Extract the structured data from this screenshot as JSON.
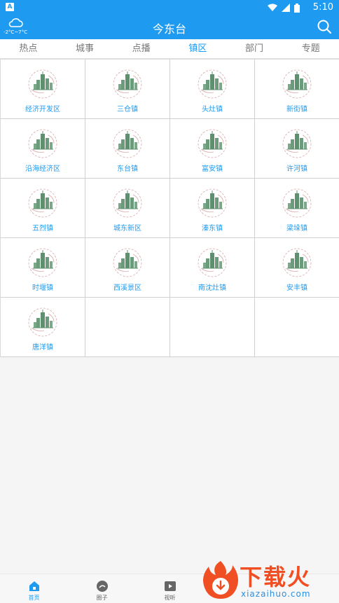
{
  "status": {
    "app_badge": "A",
    "time": "5:10"
  },
  "header": {
    "title": "今东台",
    "weather_temp": "-2°C~7°C",
    "weather_icon": "cloud-icon",
    "search_icon": "search-icon"
  },
  "tabs": [
    {
      "label": "热点"
    },
    {
      "label": "城事"
    },
    {
      "label": "点播"
    },
    {
      "label": "镇区",
      "active": true
    },
    {
      "label": "部门"
    },
    {
      "label": "专题"
    }
  ],
  "grid": {
    "items": [
      {
        "label": "经济开发区"
      },
      {
        "label": "三仓镇"
      },
      {
        "label": "头灶镇"
      },
      {
        "label": "新街镇"
      },
      {
        "label": "沿海经济区"
      },
      {
        "label": "东台镇"
      },
      {
        "label": "富安镇"
      },
      {
        "label": "许河镇"
      },
      {
        "label": "五烈镇"
      },
      {
        "label": "城东新区"
      },
      {
        "label": "溱东镇"
      },
      {
        "label": "梁垛镇"
      },
      {
        "label": "时堰镇"
      },
      {
        "label": "西溪景区"
      },
      {
        "label": "南沈灶镇"
      },
      {
        "label": "安丰镇"
      },
      {
        "label": "唐洋镇"
      },
      {
        "label": ""
      },
      {
        "label": ""
      },
      {
        "label": ""
      }
    ]
  },
  "bottom_nav": [
    {
      "label": "首页",
      "icon": "home-icon",
      "active": true
    },
    {
      "label": "圈子",
      "icon": "chat-bubble-icon"
    },
    {
      "label": "视听",
      "icon": "play-icon"
    }
  ],
  "watermark": {
    "text": "下载火",
    "sub": "xiazaihuo.com"
  },
  "colors": {
    "primary": "#1e9bf0",
    "watermark_red": "#f04e23"
  }
}
